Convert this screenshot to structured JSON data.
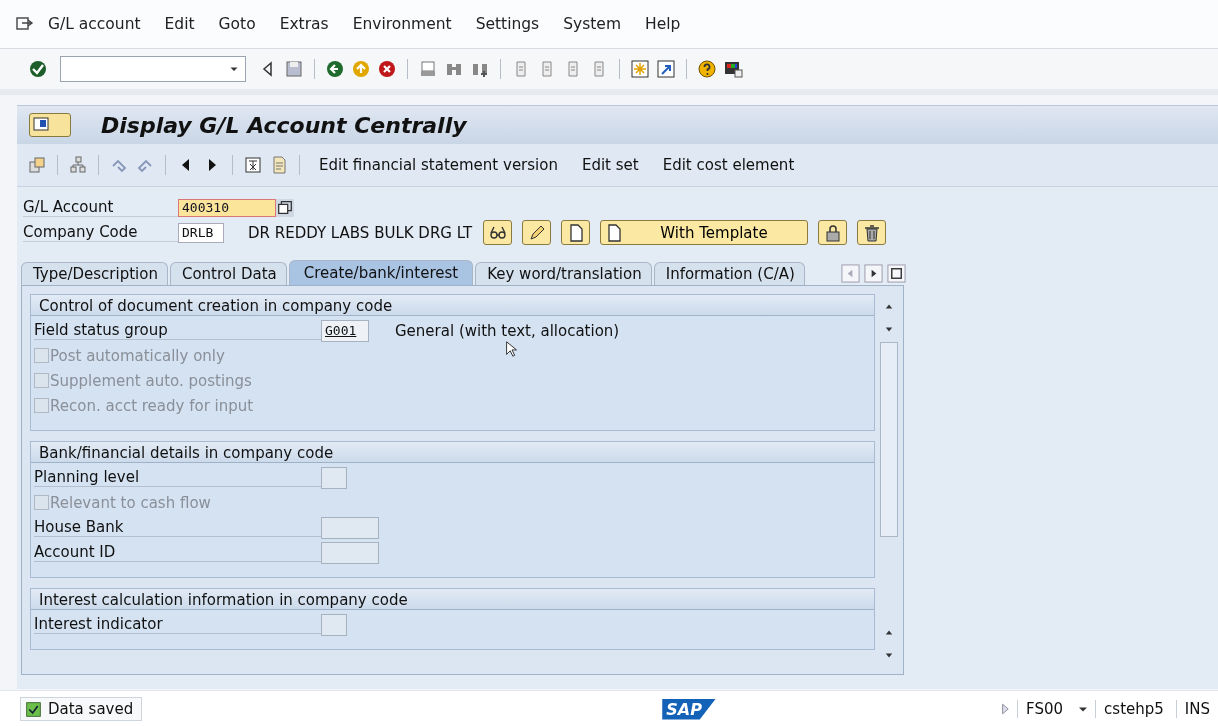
{
  "menu_bar": {
    "items": [
      "G/L account",
      "Edit",
      "Goto",
      "Extras",
      "Environment",
      "Settings",
      "System",
      "Help"
    ]
  },
  "title": "Display G/L Account Centrally",
  "application_toolbar": {
    "buttons": [
      "Edit financial statement version",
      "Edit set",
      "Edit cost element"
    ]
  },
  "header": {
    "gl_account": {
      "label": "G/L Account",
      "value": "400310"
    },
    "company_code": {
      "label": "Company Code",
      "value": "DRLB",
      "description": "DR REDDY LABS BULK DRG LT"
    },
    "template_button": "With Template"
  },
  "tabs": [
    {
      "label": "Type/Description",
      "selected": false
    },
    {
      "label": "Control Data",
      "selected": false
    },
    {
      "label": "Create/bank/interest",
      "selected": true
    },
    {
      "label": "Key word/translation",
      "selected": false
    },
    {
      "label": "Information (C/A)",
      "selected": false
    }
  ],
  "sections": [
    {
      "title": "Control of document creation in company code",
      "rows": [
        {
          "kind": "field",
          "label": "Field status group",
          "value": "G001",
          "description": "General (with text, allocation)"
        },
        {
          "kind": "checkbox",
          "label": "Post automatically only",
          "checked": false,
          "disabled": true
        },
        {
          "kind": "checkbox",
          "label": "Supplement auto. postings",
          "checked": false,
          "disabled": true
        },
        {
          "kind": "checkbox",
          "label": "Recon. acct ready for input",
          "checked": false,
          "disabled": true
        }
      ]
    },
    {
      "title": "Bank/financial details in company code",
      "rows": [
        {
          "kind": "field",
          "label": "Planning level"
        },
        {
          "kind": "checkbox",
          "label": "Relevant to cash flow",
          "checked": false,
          "disabled": true
        },
        {
          "kind": "field",
          "label": "House Bank"
        },
        {
          "kind": "field",
          "label": "Account ID"
        }
      ]
    },
    {
      "title": "Interest calculation information in company code",
      "rows": [
        {
          "kind": "field",
          "label": "Interest indicator"
        }
      ]
    }
  ],
  "status_bar": {
    "message": {
      "text": "Data saved",
      "kind": "success"
    },
    "logo": "SAP",
    "transaction": "FS00",
    "server": "cstehp5",
    "mode": "INS"
  }
}
